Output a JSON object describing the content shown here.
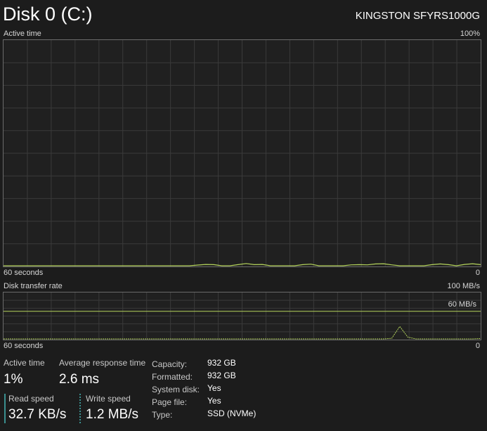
{
  "header": {
    "title": "Disk 0 (C:)",
    "model": "KINGSTON SFYRS1000G"
  },
  "active_graph": {
    "label": "Active time",
    "max_label": "100%",
    "time_label": "60 seconds",
    "min_label": "0",
    "line_color": "#b5d45c",
    "grid_color": "#3a3a3a"
  },
  "transfer_graph": {
    "label": "Disk transfer rate",
    "max_label": "100 MB/s",
    "ref_label": "60 MB/s",
    "ref_value_mbs": 60,
    "max_value_mbs": 100,
    "time_label": "60 seconds",
    "min_label": "0",
    "line_color": "#b5d45c"
  },
  "stats": {
    "active_time": {
      "label": "Active time",
      "value": "1%"
    },
    "avg_response": {
      "label": "Average response time",
      "value": "2.6 ms"
    },
    "read_speed": {
      "label": "Read speed",
      "value": "32.7 KB/s"
    },
    "write_speed": {
      "label": "Write speed",
      "value": "1.2 MB/s"
    }
  },
  "properties": [
    {
      "key": "Capacity:",
      "value": "932 GB"
    },
    {
      "key": "Formatted:",
      "value": "932 GB"
    },
    {
      "key": "System disk:",
      "value": "Yes"
    },
    {
      "key": "Page file:",
      "value": "Yes"
    },
    {
      "key": "Type:",
      "value": "SSD (NVMe)"
    }
  ],
  "series": {
    "active_time_percent": [
      0,
      0,
      0,
      0,
      0,
      0,
      0,
      0,
      0,
      0,
      0,
      0,
      0,
      0,
      0,
      0,
      0,
      0,
      0,
      0,
      0,
      0,
      0,
      0,
      0.3,
      0.6,
      0.5,
      0,
      0,
      0.5,
      1,
      0.5,
      0.6,
      0,
      0,
      0,
      0,
      0.5,
      0.7,
      0,
      0,
      0,
      0,
      0.4,
      0.5,
      0.4,
      0.8,
      0.9,
      0.4,
      0,
      0,
      0,
      0,
      0.5,
      0.8,
      0.5,
      0,
      0.6,
      0.9,
      0.5
    ],
    "transfer_rate_mbs": [
      0,
      0,
      0,
      0,
      0,
      0,
      0,
      0,
      0,
      0,
      0,
      0,
      0,
      0,
      0,
      0,
      0,
      0,
      0,
      0,
      0,
      0,
      0,
      0,
      0,
      0,
      0,
      0,
      0,
      0,
      0,
      0,
      0,
      0,
      0,
      0,
      0,
      0,
      0,
      0,
      0,
      0,
      0,
      0,
      0,
      0,
      0,
      0,
      0.5,
      11,
      1.5,
      0,
      0,
      0,
      0,
      0,
      0,
      0,
      0,
      0.3
    ]
  }
}
